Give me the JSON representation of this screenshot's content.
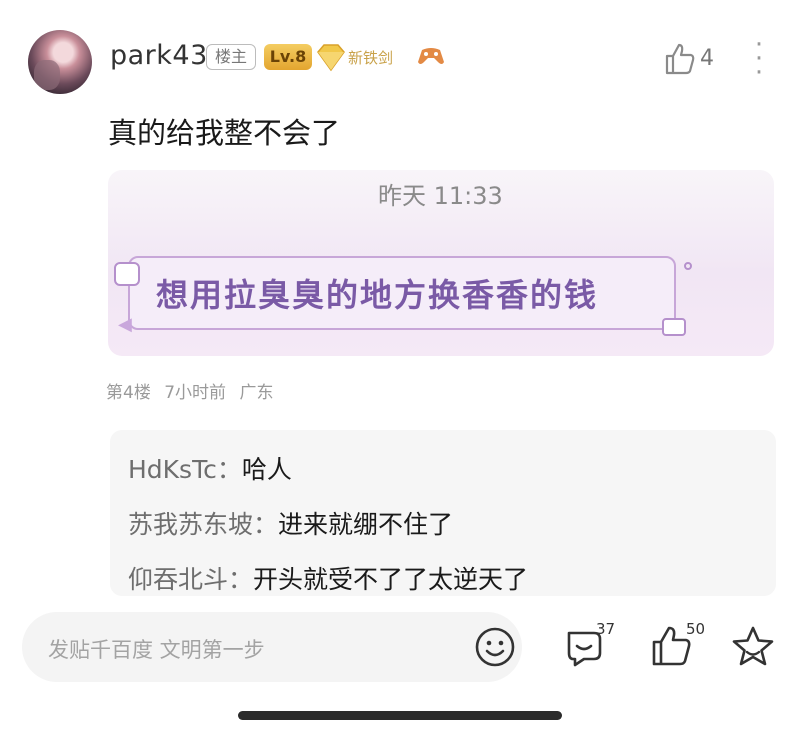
{
  "post": {
    "username": "park43",
    "owner_badge": "楼主",
    "level_badge": "Lv.8",
    "title_badge": "新铁剑",
    "like_count": "4",
    "text": "真的给我整不会了",
    "quote": {
      "time": "昨天 11:33",
      "banner_text": "想用拉臭臭的地方换香香的钱"
    },
    "meta": {
      "floor": "第4楼",
      "time_ago": "7小时前",
      "location": "广东"
    }
  },
  "replies": [
    {
      "user": "HdKsTc：",
      "text": "哈人"
    },
    {
      "user": "苏我苏东坡：",
      "text": "进来就绷不住了"
    },
    {
      "user": "仰吞北斗：",
      "text": "开头就受不了了太逆天了"
    }
  ],
  "bottom_bar": {
    "input_placeholder": "发贴千百度 文明第一步",
    "comment_count": "37",
    "like_count": "50"
  },
  "icons": {
    "avatar": "user-avatar",
    "badge_gem": "diamond-icon",
    "game": "gamepad-icon",
    "like": "thumbs-up-icon",
    "more": "more-vertical-icon",
    "emoji": "smiley-icon",
    "comment": "comment-icon",
    "star": "star-icon"
  },
  "colors": {
    "accent_purple": "#7a5aa6",
    "level_gold": "#e3a52f",
    "muted_gray": "#9a9a9a"
  }
}
